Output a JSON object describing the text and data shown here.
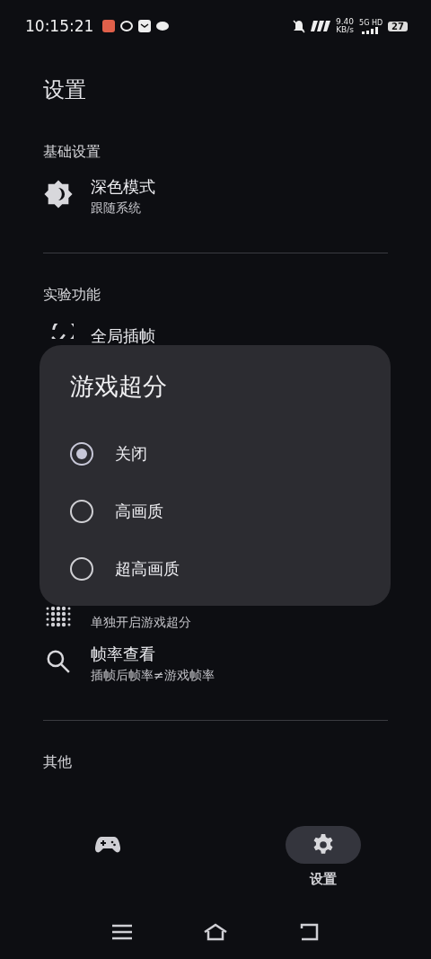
{
  "status_bar": {
    "time": "10:15:21",
    "speed": "9.40",
    "speed_unit": "KB/s",
    "network": "5G HD",
    "battery": "27"
  },
  "page_title": "设置",
  "sections": [
    {
      "heading": "基础设置",
      "items": [
        {
          "title": "深色模式",
          "subtitle": "跟随系统"
        }
      ]
    },
    {
      "heading": "实验功能",
      "items": [
        {
          "title": "全局插帧"
        },
        {
          "subtitle": "单独开启游戏超分"
        },
        {
          "title": "帧率查看",
          "subtitle": "插帧后帧率≠游戏帧率"
        }
      ]
    },
    {
      "heading": "其他"
    }
  ],
  "dialog": {
    "title": "游戏超分",
    "options": [
      {
        "label": "关闭",
        "selected": true
      },
      {
        "label": "高画质",
        "selected": false
      },
      {
        "label": "超高画质",
        "selected": false
      }
    ]
  },
  "bottom_nav": [
    {
      "selected": false
    },
    {
      "label": "设置",
      "selected": true
    }
  ]
}
